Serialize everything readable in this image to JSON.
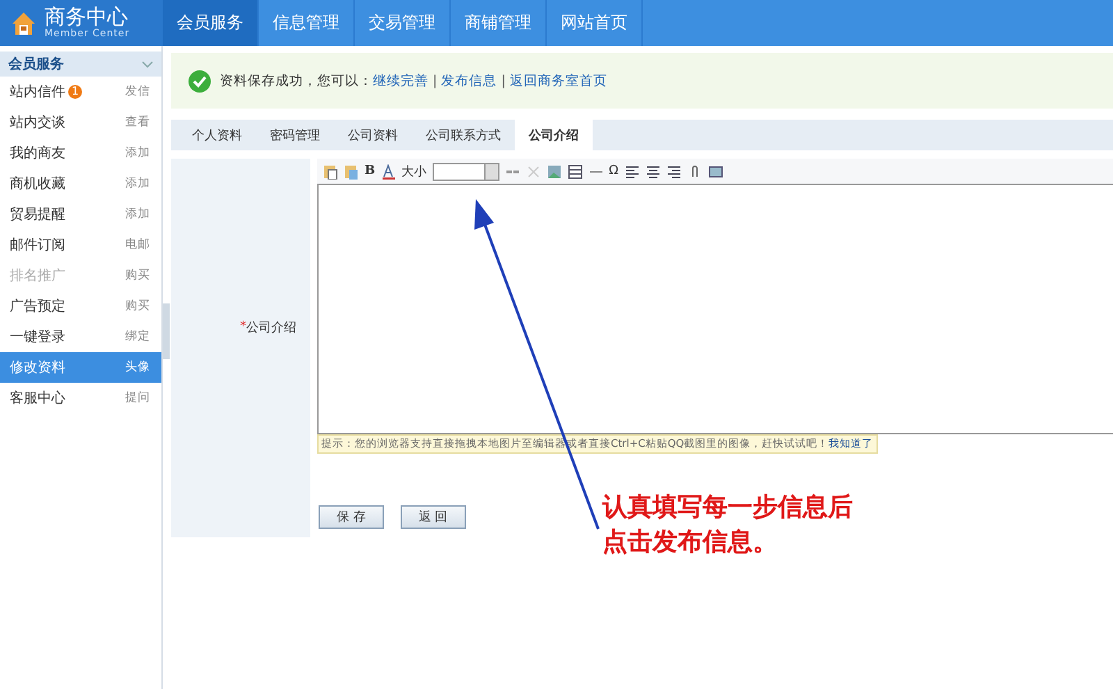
{
  "header": {
    "logo_title": "商务中心",
    "logo_subtitle": "Member Center",
    "nav": [
      {
        "label": "会员服务",
        "selected": true
      },
      {
        "label": "信息管理",
        "selected": false
      },
      {
        "label": "交易管理",
        "selected": false
      },
      {
        "label": "商铺管理",
        "selected": false
      },
      {
        "label": "网站首页",
        "selected": false
      }
    ]
  },
  "sidebar": {
    "title": "会员服务",
    "items": [
      {
        "label": "站内信件",
        "badge": "1",
        "action": "发信",
        "selected": false,
        "disabled": false
      },
      {
        "label": "站内交谈",
        "action": "查看",
        "selected": false,
        "disabled": false
      },
      {
        "label": "我的商友",
        "action": "添加",
        "selected": false,
        "disabled": false
      },
      {
        "label": "商机收藏",
        "action": "添加",
        "selected": false,
        "disabled": false
      },
      {
        "label": "贸易提醒",
        "action": "添加",
        "selected": false,
        "disabled": false
      },
      {
        "label": "邮件订阅",
        "action": "电邮",
        "selected": false,
        "disabled": false
      },
      {
        "label": "排名推广",
        "action": "购买",
        "selected": false,
        "disabled": true
      },
      {
        "label": "广告预定",
        "action": "购买",
        "selected": false,
        "disabled": false
      },
      {
        "label": "一键登录",
        "action": "绑定",
        "selected": false,
        "disabled": false
      },
      {
        "label": "修改资料",
        "action": "头像",
        "selected": true,
        "disabled": false
      },
      {
        "label": "客服中心",
        "action": "提问",
        "selected": false,
        "disabled": false
      }
    ]
  },
  "notice": {
    "message": "资料保存成功，您可以：",
    "links": [
      "继续完善",
      "发布信息",
      "返回商务室首页"
    ],
    "separator": "|"
  },
  "tabs": [
    {
      "label": "个人资料",
      "selected": false
    },
    {
      "label": "密码管理",
      "selected": false
    },
    {
      "label": "公司资料",
      "selected": false
    },
    {
      "label": "公司联系方式",
      "selected": false
    },
    {
      "label": "公司介绍",
      "selected": true
    }
  ],
  "form": {
    "required_mark": "*",
    "label": "公司介绍",
    "toolbar": {
      "bold": "B",
      "font_size_label": "大小",
      "special_char": "Ω"
    },
    "tip": "提示：您的浏览器支持直接拖拽本地图片至编辑器或者直接Ctrl+C粘贴QQ截图里的图像，赶快试试吧！",
    "tip_link": "我知道了",
    "buttons": [
      "保 存",
      "返 回"
    ]
  },
  "annotation": {
    "lines": [
      "认真填写每一步信息后",
      "点击发布信息。"
    ]
  }
}
